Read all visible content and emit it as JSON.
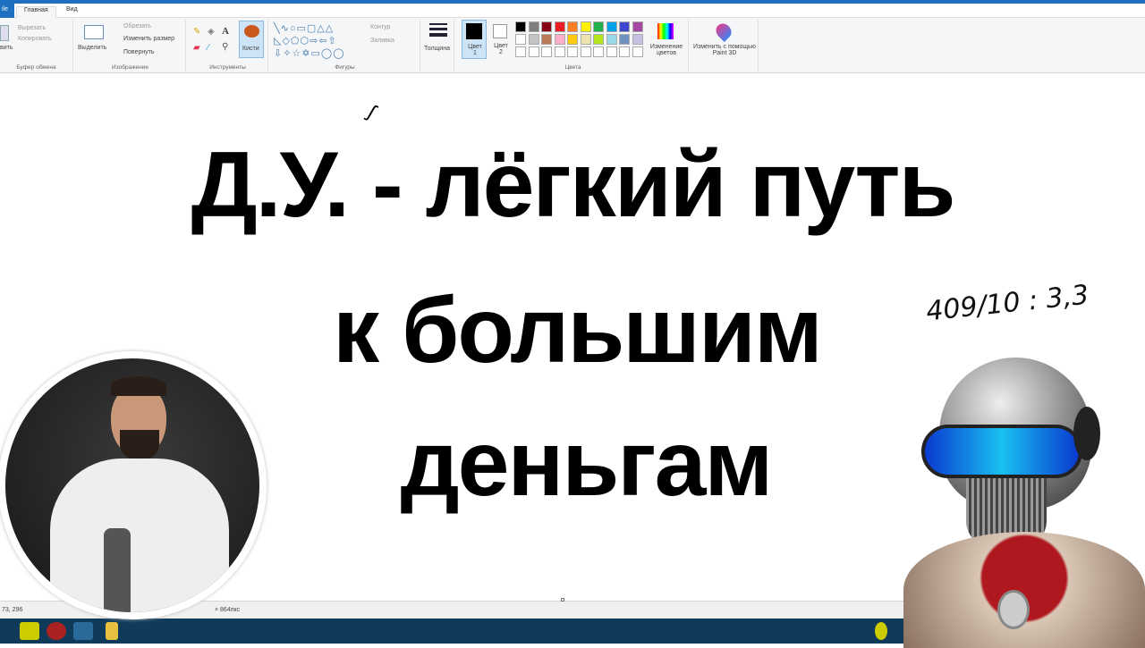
{
  "tabs": {
    "file": "ile",
    "home": "Главная",
    "view": "Вид"
  },
  "ribbon": {
    "clipboard": {
      "paste": "вить",
      "cut": "Вырезать",
      "copy": "Копировать",
      "label": "Буфер обмена"
    },
    "image": {
      "select": "Выделить",
      "crop": "Обрезать",
      "resize": "Изменить размер",
      "rotate": "Повернуть",
      "label": "Изображение"
    },
    "tools": {
      "label": "Инструменты",
      "brushes": "Кисти"
    },
    "shapes": {
      "outline": "Контур",
      "fill": "Заливка",
      "label": "Фигуры"
    },
    "size": {
      "label": "Толщина"
    },
    "colors": {
      "color1": "Цвет 1",
      "color2": "Цвет 2",
      "edit": "Изменение цветов",
      "label": "Цвета",
      "row1": [
        "#000000",
        "#7f7f7f",
        "#880015",
        "#ed1c24",
        "#ff7f27",
        "#fff200",
        "#22b14c",
        "#00a2e8",
        "#3f48cc",
        "#a349a4"
      ],
      "row2": [
        "#ffffff",
        "#c3c3c3",
        "#b97a57",
        "#ffaec9",
        "#ffc90e",
        "#efe4b0",
        "#b5e61d",
        "#99d9ea",
        "#7092be",
        "#c8bfe7"
      ]
    },
    "paint3d": {
      "label": "Изменить с помощью Paint 3D"
    }
  },
  "canvas": {
    "line1": "Д.У. - лёгкий путь",
    "line2": "к большим",
    "line3": "деньгам",
    "handwriting": "409/10 : 3,3"
  },
  "status": {
    "cursor": "73, 296",
    "size": "× 864пкс"
  }
}
